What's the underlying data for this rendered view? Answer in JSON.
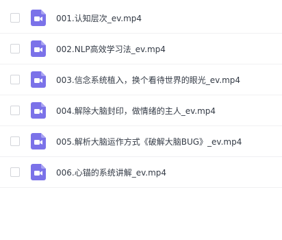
{
  "files": [
    {
      "name": "001.认知层次_ev.mp4",
      "icon": "video-file-icon"
    },
    {
      "name": "002.NLP高效学习法_ev.mp4",
      "icon": "video-file-icon"
    },
    {
      "name": "003.信念系统植入，换个看待世界的眼光_ev.mp4",
      "icon": "video-file-icon"
    },
    {
      "name": "004.解除大脑封印，做情绪的主人_ev.mp4",
      "icon": "video-file-icon"
    },
    {
      "name": "005.解析大脑运作方式《破解大脑BUG》_ev.mp4",
      "icon": "video-file-icon"
    },
    {
      "name": "006.心锚的系统讲解_ev.mp4",
      "icon": "video-file-icon"
    }
  ],
  "colors": {
    "icon_bg": "#7b72e9",
    "text": "#333a45",
    "divider": "#f0f0f2",
    "checkbox_border": "#d3d5da"
  }
}
